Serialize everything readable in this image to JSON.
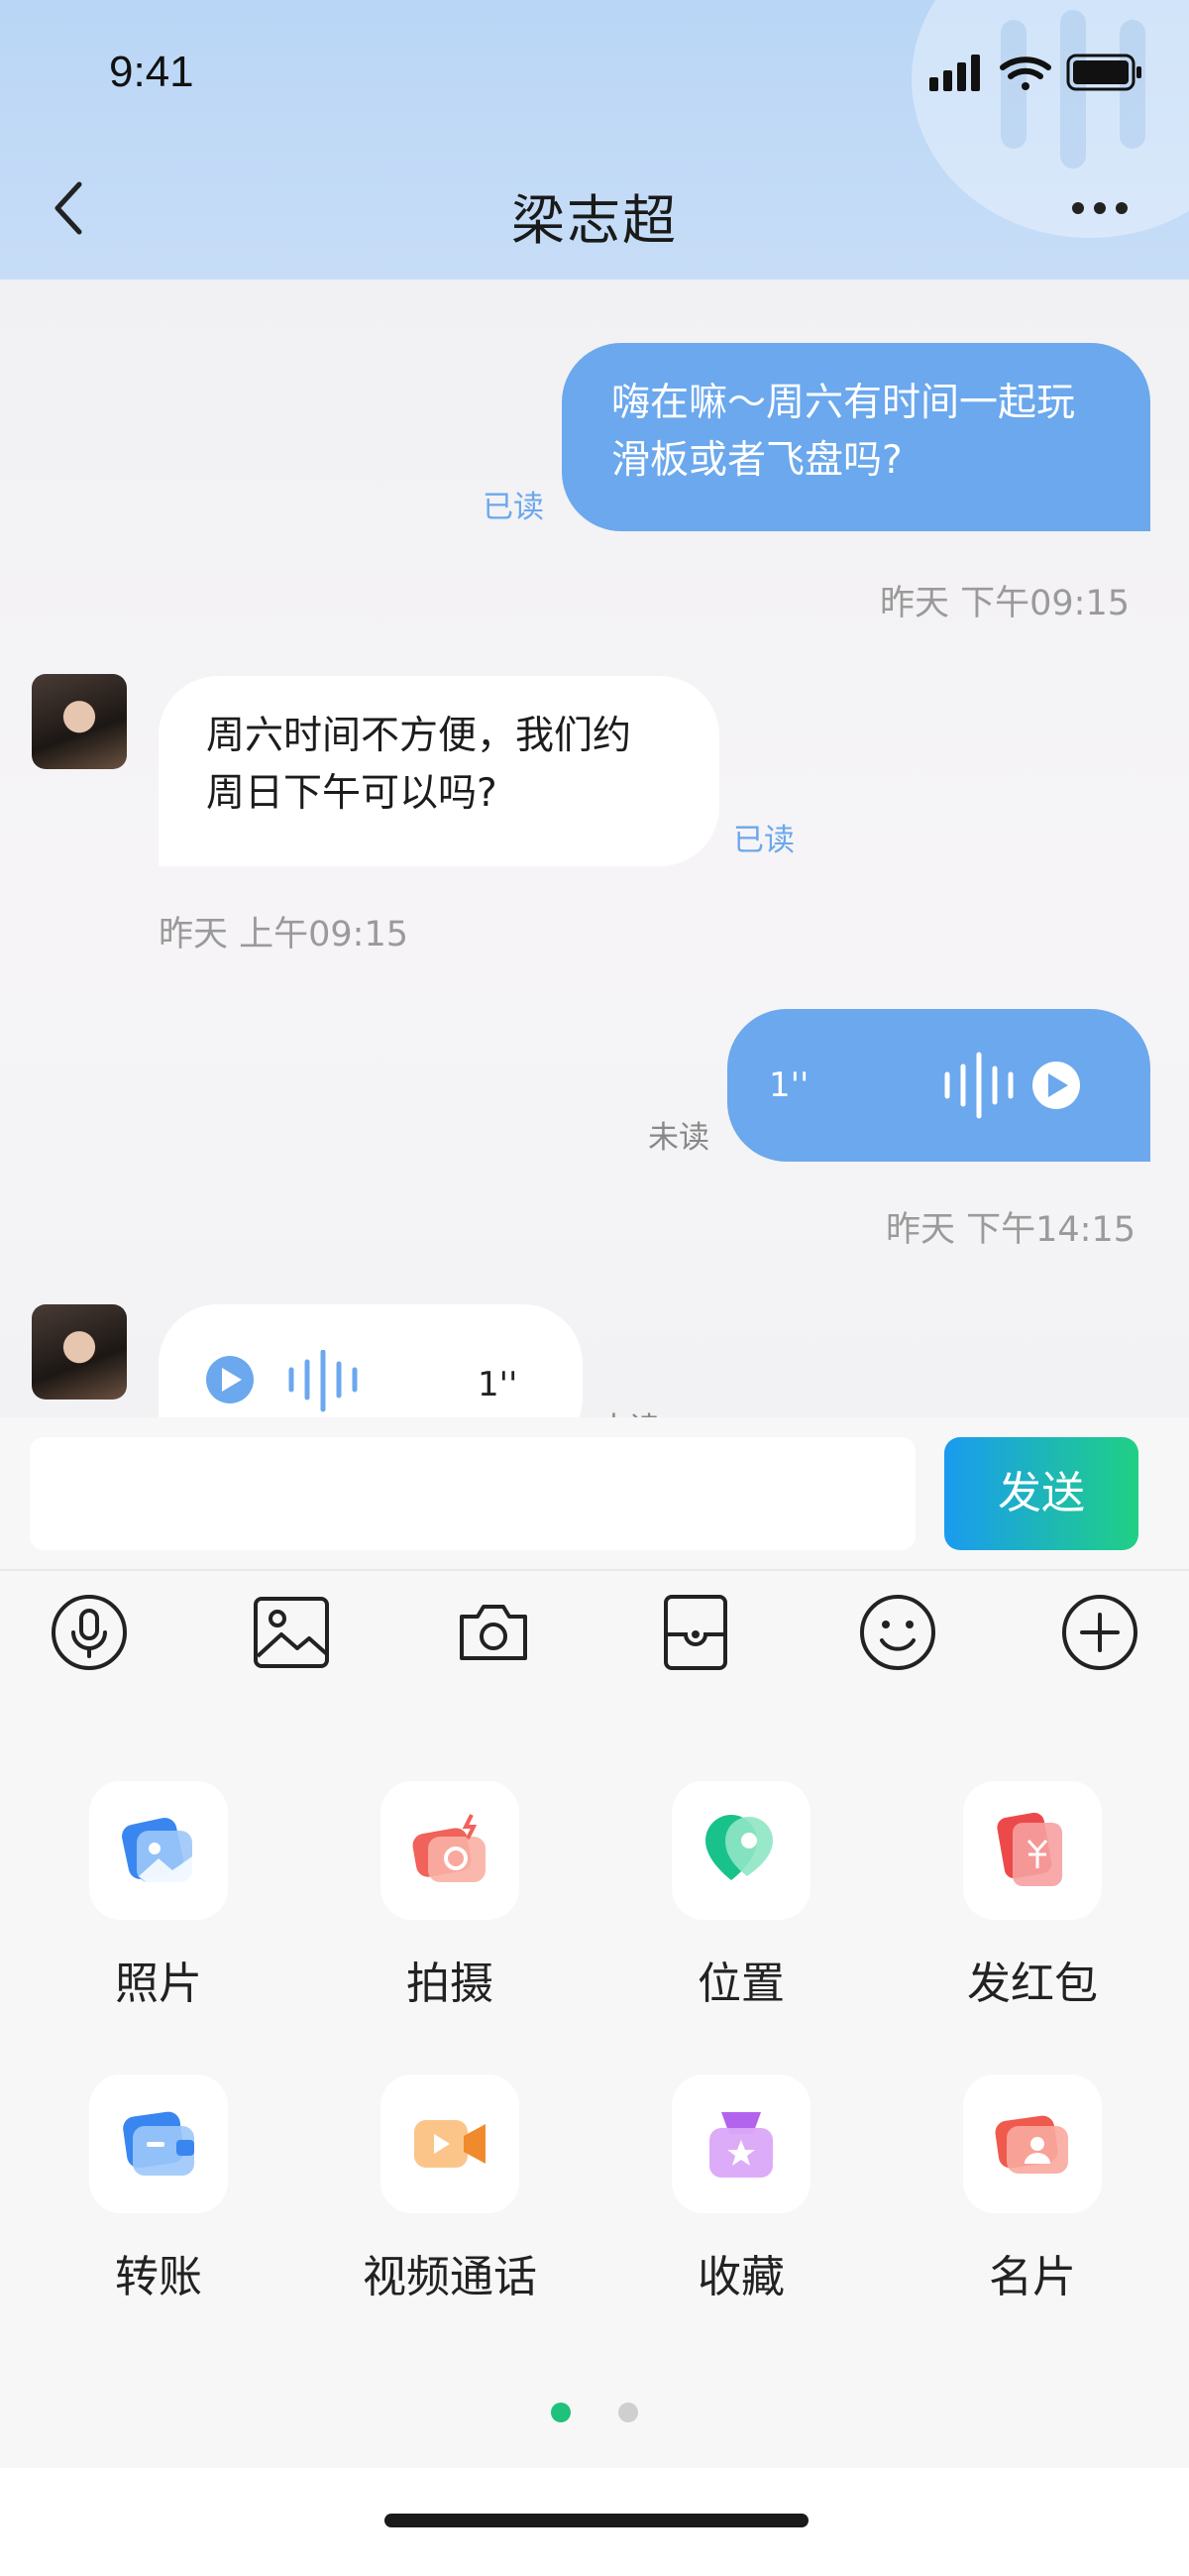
{
  "status_bar": {
    "time": "9:41"
  },
  "header": {
    "title": "梁志超"
  },
  "messages": [
    {
      "direction": "out",
      "type": "text",
      "line1": "嗨在嘛～周六有时间一起玩",
      "line2": "滑板或者飞盘吗?",
      "status": "已读",
      "time": "昨天  下午09:15"
    },
    {
      "direction": "in",
      "type": "text",
      "line1": "周六时间不方便，我们约",
      "line2": "周日下午可以吗?",
      "status": "已读",
      "time": "昨天  上午09:15"
    },
    {
      "direction": "out",
      "type": "voice",
      "duration": "1''",
      "status": "未读",
      "time": "昨天  下午14:15"
    },
    {
      "direction": "in",
      "type": "voice",
      "duration": "1''",
      "status": "未读"
    }
  ],
  "composer": {
    "value": "",
    "placeholder": "",
    "send_label": "发送"
  },
  "toolbar": [
    "microphone-icon",
    "image-icon",
    "camera-icon",
    "wallet-icon",
    "emoji-icon",
    "plus-icon"
  ],
  "functions": [
    {
      "label": "照片",
      "icon": "photo-icon"
    },
    {
      "label": "拍摄",
      "icon": "camera-shoot-icon"
    },
    {
      "label": "位置",
      "icon": "location-icon"
    },
    {
      "label": "发红包",
      "icon": "red-packet-icon"
    },
    {
      "label": "转账",
      "icon": "transfer-icon"
    },
    {
      "label": "视频通话",
      "icon": "video-call-icon"
    },
    {
      "label": "收藏",
      "icon": "favorites-icon"
    },
    {
      "label": "名片",
      "icon": "contact-card-icon"
    }
  ],
  "pager": {
    "pages": 2,
    "active": 1
  },
  "colors": {
    "accent": "#6ba8ed",
    "send_gradient": [
      "#1a9bf0",
      "#20d084"
    ],
    "active_dot": "#1ec27a"
  }
}
